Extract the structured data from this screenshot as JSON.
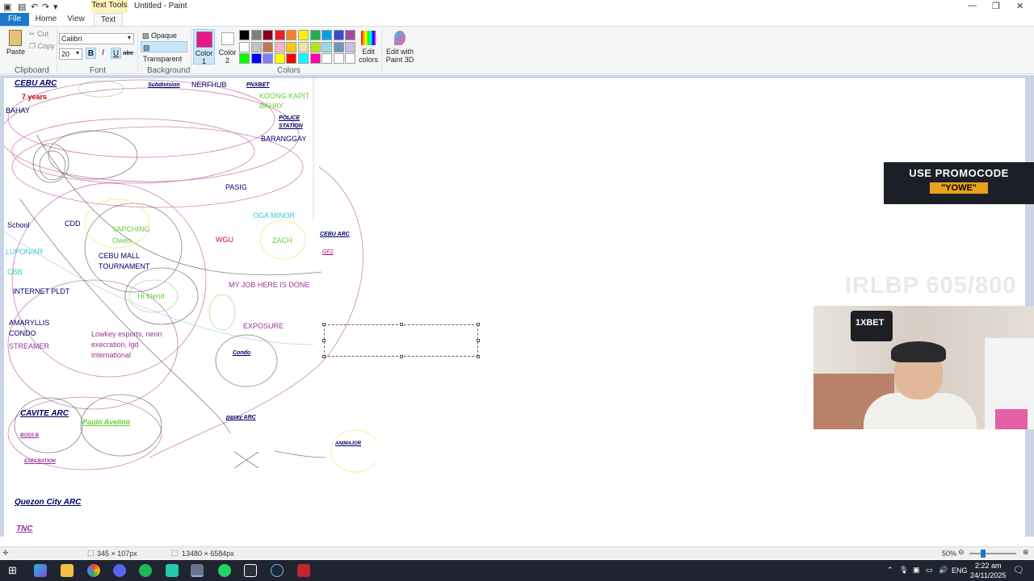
{
  "window": {
    "title": "Untitled - Paint",
    "context_tab": "Text Tools"
  },
  "tabs": {
    "file": "File",
    "home": "Home",
    "view": "View",
    "text": "Text"
  },
  "ribbon": {
    "clipboard": {
      "paste": "Paste",
      "cut": "Cut",
      "copy": "Copy",
      "label": "Clipboard"
    },
    "font": {
      "name": "Calibri",
      "size": "20",
      "bold": "B",
      "italic": "I",
      "underline": "U",
      "strike": "abc",
      "label": "Font"
    },
    "background": {
      "opaque": "Opaque",
      "transparent": "Transparent",
      "label": "Background"
    },
    "colors": {
      "color1": "Color 1",
      "color2": "Color 2",
      "edit": "Edit colors",
      "label": "Colors",
      "color1_value": "#e8168a",
      "color2_value": "#ffffff",
      "palette": [
        "#000000",
        "#7f7f7f",
        "#880015",
        "#ed1c24",
        "#ff7f27",
        "#fff200",
        "#22b14c",
        "#00a2e8",
        "#3f48cc",
        "#a349a4",
        "#ffffff",
        "#c3c3c3",
        "#b97a57",
        "#ffaec9",
        "#ffc90e",
        "#efe4b0",
        "#b5e61d",
        "#99d9ea",
        "#7092be",
        "#c8bfe7",
        "#00ff00",
        "#0000ff",
        "#8080ff",
        "#ffff00",
        "#ff0000",
        "#00ffff",
        "#ff00aa",
        "#ffffff",
        "#ffffff",
        "#ffffff"
      ]
    },
    "paint3d": "Edit with Paint 3D"
  },
  "canvas": {
    "labels": [
      {
        "t": "CEBU ARC",
        "c": "#000066",
        "b": true,
        "i": true,
        "u": true,
        "s": 10
      },
      {
        "t": "7 years",
        "c": "#cc0000",
        "b": true,
        "i": false,
        "u": false,
        "s": 9
      },
      {
        "t": "BAHAY",
        "c": "#000066",
        "b": false,
        "i": false,
        "u": false,
        "s": 9
      },
      {
        "t": "Subdivision",
        "c": "#000066",
        "b": true,
        "i": true,
        "u": true,
        "s": 7
      },
      {
        "t": "NERFHUB",
        "c": "#000066",
        "b": false,
        "i": false,
        "u": false,
        "s": 9
      },
      {
        "t": "PNXBET",
        "c": "#000066",
        "b": true,
        "i": true,
        "u": true,
        "s": 7
      },
      {
        "t": "KOONG KAPIT",
        "c": "#66cc33",
        "b": false,
        "i": false,
        "u": false,
        "s": 9
      },
      {
        "t": "BAHAY",
        "c": "#66cc33",
        "b": false,
        "i": false,
        "u": false,
        "s": 9
      },
      {
        "t": "POLICE",
        "c": "#000066",
        "b": true,
        "i": true,
        "u": true,
        "s": 7
      },
      {
        "t": "STATION",
        "c": "#000066",
        "b": true,
        "i": true,
        "u": true,
        "s": 7
      },
      {
        "t": "BARANGGAY",
        "c": "#000066",
        "b": false,
        "i": false,
        "u": false,
        "s": 9
      },
      {
        "t": "PASIG",
        "c": "#000066",
        "b": false,
        "i": false,
        "u": false,
        "s": 9
      },
      {
        "t": "OGA MINOR",
        "c": "#33cccc",
        "b": false,
        "i": false,
        "u": false,
        "s": 9
      },
      {
        "t": "School",
        "c": "#000066",
        "b": false,
        "i": false,
        "u": false,
        "s": 9
      },
      {
        "t": "CDD",
        "c": "#000066",
        "b": false,
        "i": false,
        "u": false,
        "s": 9
      },
      {
        "t": "YAPCHING",
        "c": "#66cc33",
        "b": false,
        "i": false,
        "u": false,
        "s": 9
      },
      {
        "t": "Owen",
        "c": "#66cc33",
        "b": false,
        "i": false,
        "u": false,
        "s": 9
      },
      {
        "t": "WGU",
        "c": "#cc0066",
        "b": false,
        "i": false,
        "u": false,
        "s": 9
      },
      {
        "t": "ZACH",
        "c": "#66cc33",
        "b": false,
        "i": false,
        "u": false,
        "s": 9
      },
      {
        "t": "LUPON/AR",
        "c": "#33cccc",
        "b": false,
        "i": false,
        "u": false,
        "s": 9
      },
      {
        "t": "CEBU MALL",
        "c": "#000066",
        "b": false,
        "i": false,
        "u": false,
        "s": 9
      },
      {
        "t": "TOURNAMENT",
        "c": "#000066",
        "b": false,
        "i": false,
        "u": false,
        "s": 9
      },
      {
        "t": "CBB",
        "c": "#33cccc",
        "b": false,
        "i": false,
        "u": false,
        "s": 9
      },
      {
        "t": "INTERNET PLDT",
        "c": "#000066",
        "b": false,
        "i": false,
        "u": false,
        "s": 9
      },
      {
        "t": "Hi friend",
        "c": "#66cc33",
        "b": false,
        "i": false,
        "u": false,
        "s": 9
      },
      {
        "t": "MY JOB HERE IS DONE",
        "c": "#993399",
        "b": false,
        "i": false,
        "u": false,
        "s": 9
      },
      {
        "t": "AMARYLLIS",
        "c": "#000066",
        "b": false,
        "i": false,
        "u": false,
        "s": 9
      },
      {
        "t": "CONDO",
        "c": "#000066",
        "b": false,
        "i": false,
        "u": false,
        "s": 9
      },
      {
        "t": "Lowkey esports, neon",
        "c": "#993399",
        "b": false,
        "i": false,
        "u": false,
        "s": 9
      },
      {
        "t": "execration, lgd",
        "c": "#993399",
        "b": false,
        "i": false,
        "u": false,
        "s": 9
      },
      {
        "t": "international",
        "c": "#993399",
        "b": false,
        "i": false,
        "u": false,
        "s": 9
      },
      {
        "t": "STREAMER",
        "c": "#993399",
        "b": false,
        "i": false,
        "u": false,
        "s": 9
      },
      {
        "t": "EXPOSURE",
        "c": "#993399",
        "b": false,
        "i": false,
        "u": false,
        "s": 9
      },
      {
        "t": "Condo",
        "c": "#000066",
        "b": true,
        "i": true,
        "u": true,
        "s": 7
      },
      {
        "t": "CEBU ARC",
        "c": "#000066",
        "b": true,
        "i": true,
        "u": true,
        "s": 7
      },
      {
        "t": "GF2",
        "c": "#cc0066",
        "b": false,
        "i": true,
        "u": true,
        "s": 7
      },
      {
        "t": "CAVITE ARC",
        "c": "#000066",
        "b": true,
        "i": true,
        "u": true,
        "s": 10
      },
      {
        "t": "Paulo Avelino",
        "c": "#66cc33",
        "b": true,
        "i": true,
        "u": true,
        "s": 9
      },
      {
        "t": "BOSS B",
        "c": "#993399",
        "b": true,
        "i": true,
        "u": true,
        "s": 6
      },
      {
        "t": "EXECRATION",
        "c": "#993399",
        "b": true,
        "i": true,
        "u": true,
        "s": 6
      },
      {
        "t": "pasay ARC",
        "c": "#000066",
        "b": true,
        "i": true,
        "u": true,
        "s": 7
      },
      {
        "t": "ANIMAJOR",
        "c": "#000066",
        "b": true,
        "i": true,
        "u": true,
        "s": 6
      },
      {
        "t": "Quezon City ARC",
        "c": "#000066",
        "b": true,
        "i": true,
        "u": true,
        "s": 10
      },
      {
        "t": "TNC",
        "c": "#993399",
        "b": true,
        "i": true,
        "u": true,
        "s": 10
      }
    ]
  },
  "status": {
    "selection": "345 × 107px",
    "canvas_size": "13480 × 6584px",
    "zoom": "50%"
  },
  "overlay": {
    "promo_line1": "USE PROMOCODE",
    "promo_line2": "\"YOWE\"",
    "counter": "IRLBP 605/800",
    "webcam_sign": "1XBET"
  },
  "taskbar": {
    "lang": "ENG",
    "time": "2:22 am",
    "date": "24/11/2025"
  }
}
